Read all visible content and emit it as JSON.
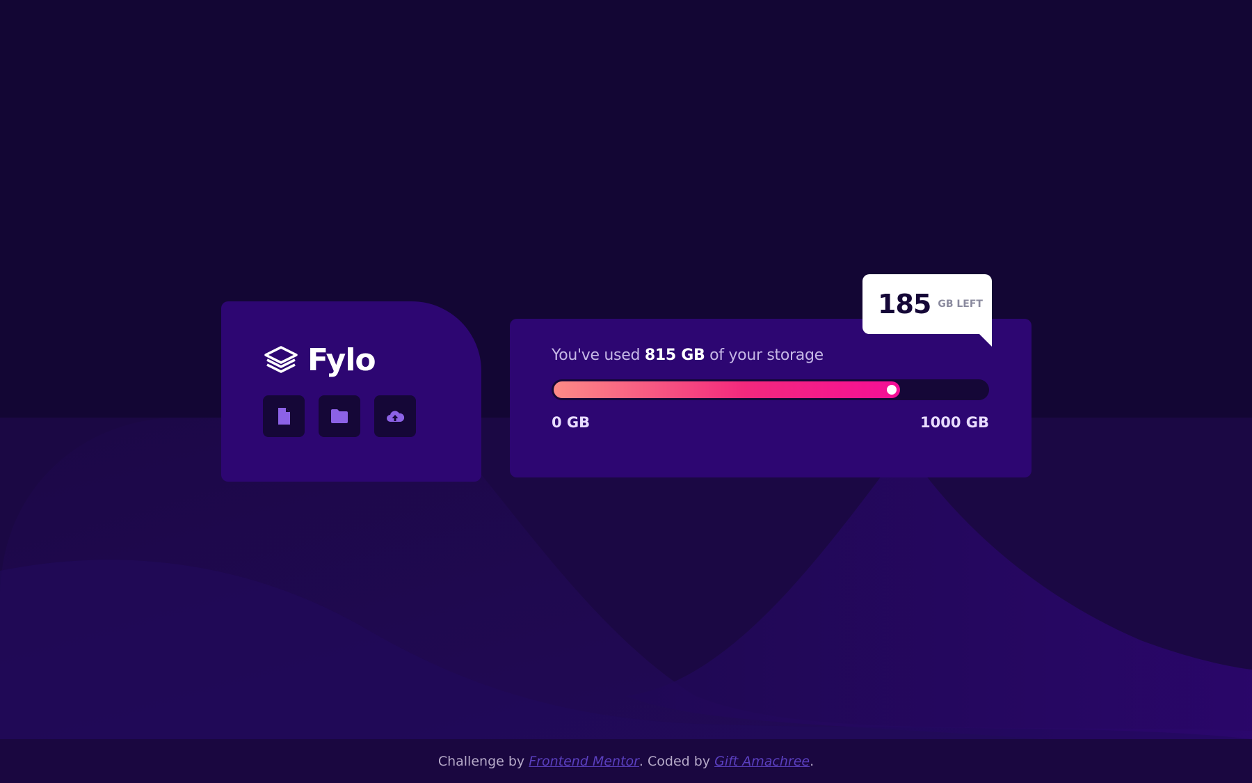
{
  "brand": {
    "name": "Fylo",
    "logo_icon": "stacked-layers-icon"
  },
  "tools": [
    {
      "name": "document-icon"
    },
    {
      "name": "folder-icon"
    },
    {
      "name": "cloud-upload-icon"
    }
  ],
  "storage": {
    "prefix": "You've used",
    "used": "815 GB",
    "suffix": "of your storage",
    "used_fraction": 0.815,
    "min_label": "0 GB",
    "max_label": "1000 GB"
  },
  "callout": {
    "value": "185",
    "unit": "GB LEFT"
  },
  "footer": {
    "challenge_text": "Challenge by",
    "challenge_link": "Frontend Mentor",
    "coded_text": ". Coded by",
    "author_link": "Gift Amachree",
    "end": "."
  },
  "colors": {
    "background": "#130634",
    "card": "#2d0672",
    "bar_start": "#fc8b87",
    "bar_end": "#f40e96",
    "icon_accent": "#8c62e6"
  }
}
